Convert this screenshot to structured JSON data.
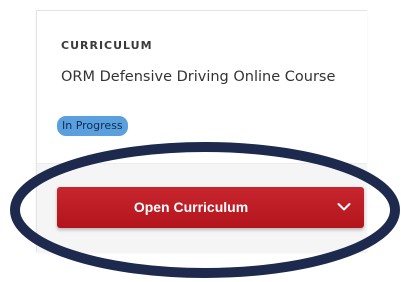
{
  "course_card": {
    "category": "CURRICULUM",
    "title": "ORM Defensive Driving Online Course",
    "status_badge": "In Progress",
    "primary_action": {
      "label": "Open Curriculum",
      "menu_icon": "chevron-down-icon"
    }
  },
  "annotation": {
    "shape": "ellipse",
    "color": "#1d2a4d"
  },
  "colors": {
    "button": "#c0202a",
    "badge": "#5aa0de",
    "footer": "#f5f5f5"
  }
}
